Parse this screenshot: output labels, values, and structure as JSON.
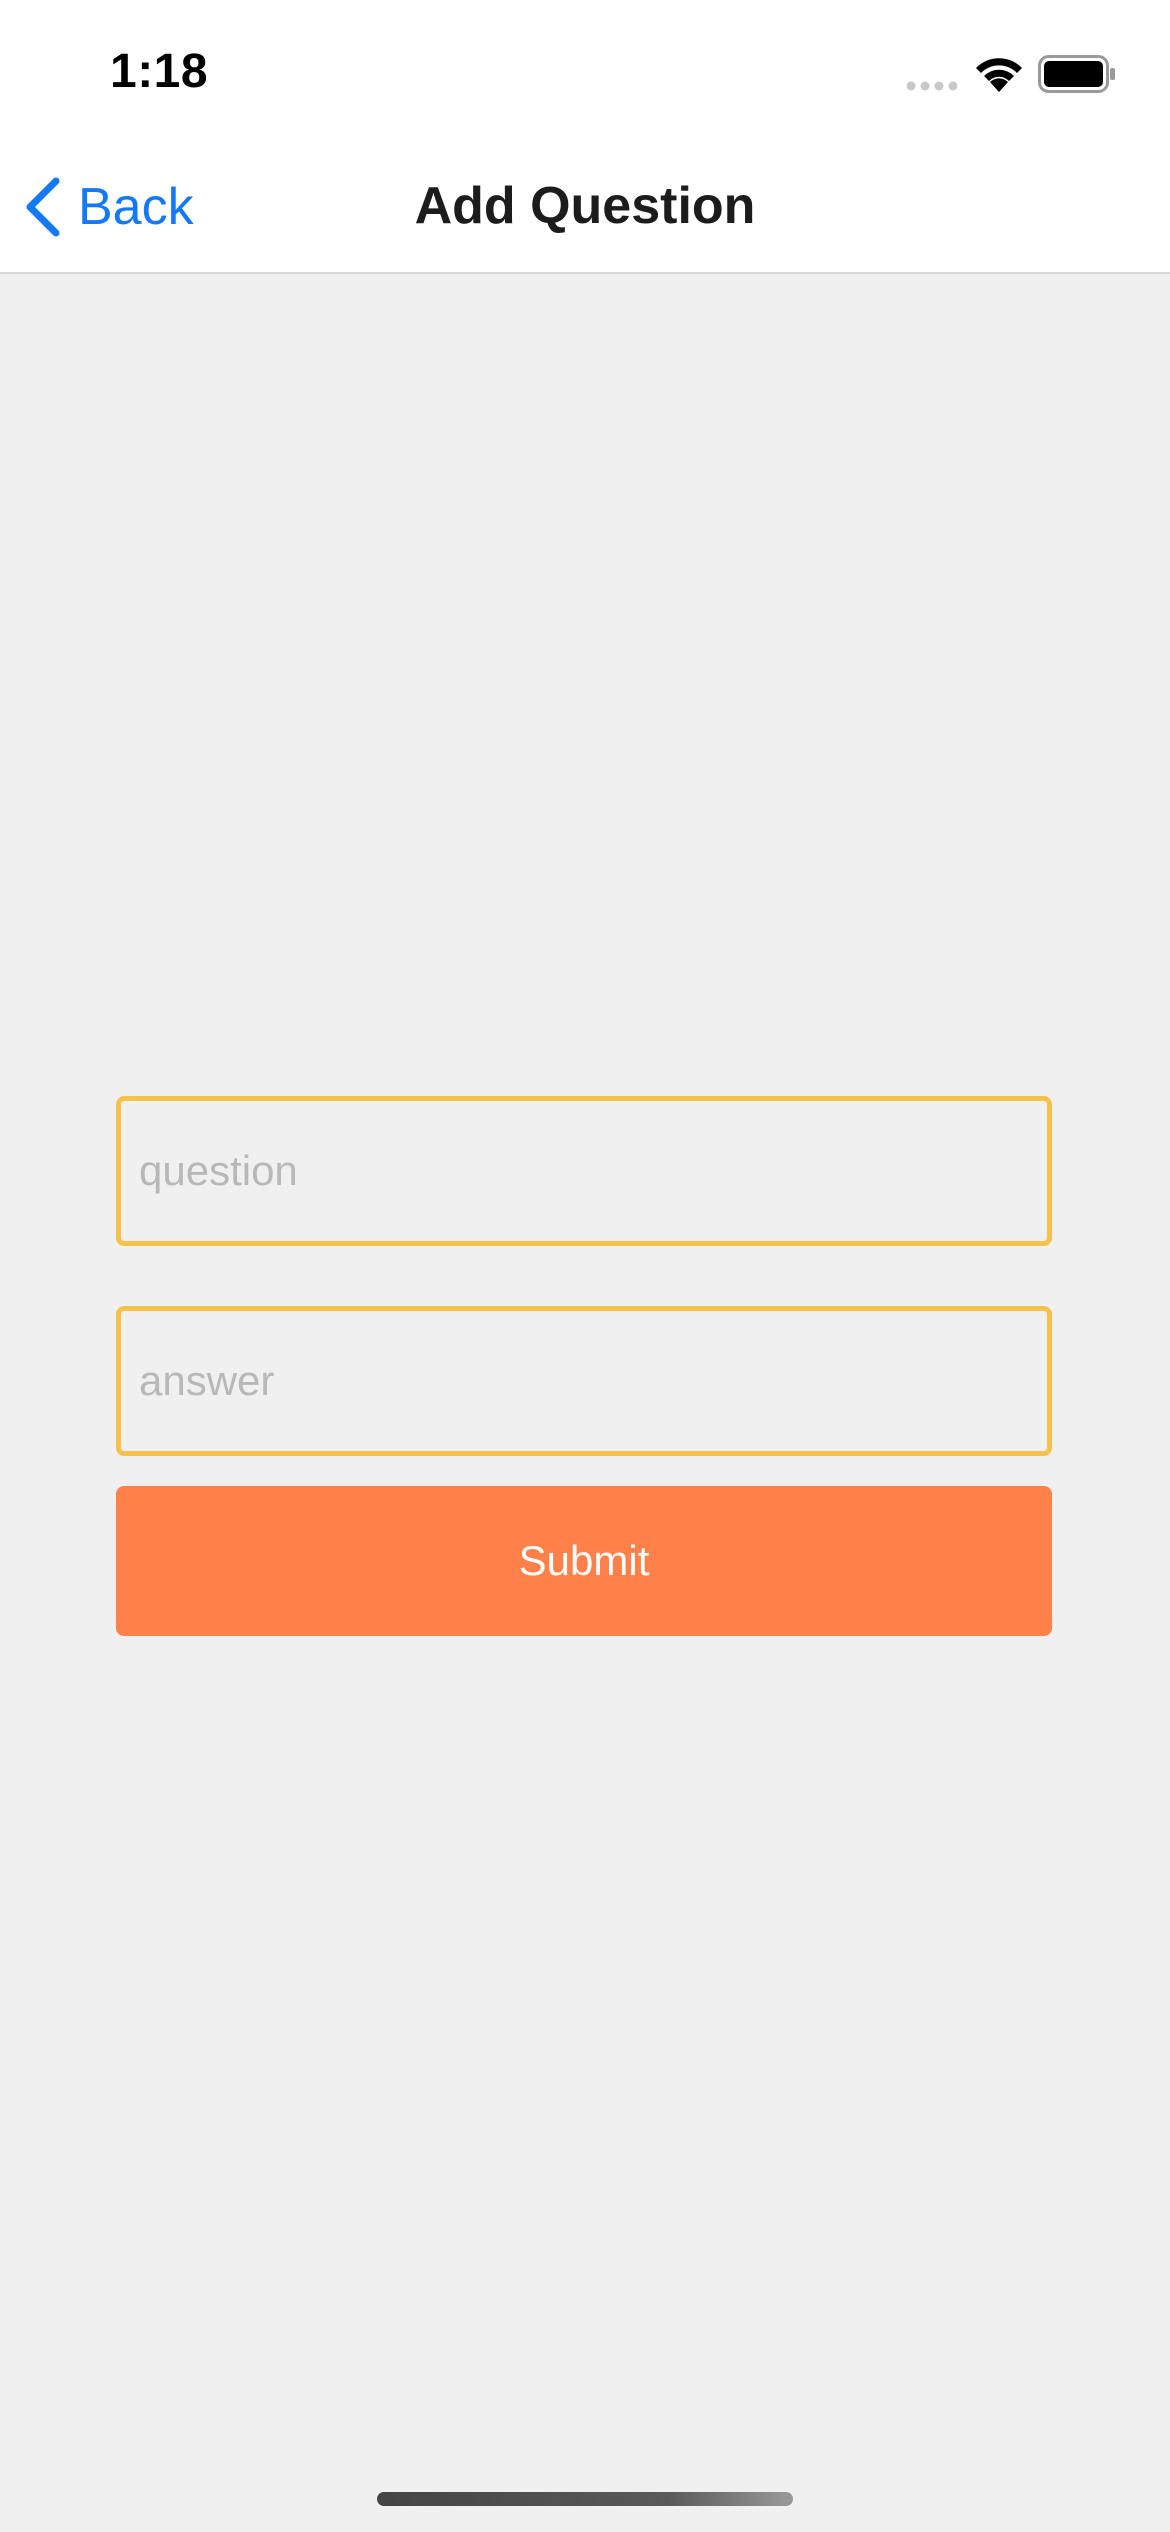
{
  "status_bar": {
    "time": "1:18",
    "icons": [
      "signal-icon",
      "wifi-icon",
      "battery-icon"
    ]
  },
  "nav": {
    "back_label": "Back",
    "title": "Add Question",
    "back_icon": "chevron-left-icon"
  },
  "form": {
    "question_placeholder": "question",
    "question_value": "",
    "answer_placeholder": "answer",
    "answer_value": "",
    "submit_label": "Submit"
  },
  "colors": {
    "accent_blue": "#1479f5",
    "field_border": "#f7c24c",
    "submit_bg": "#ff8049",
    "background": "#f0f0f0"
  }
}
